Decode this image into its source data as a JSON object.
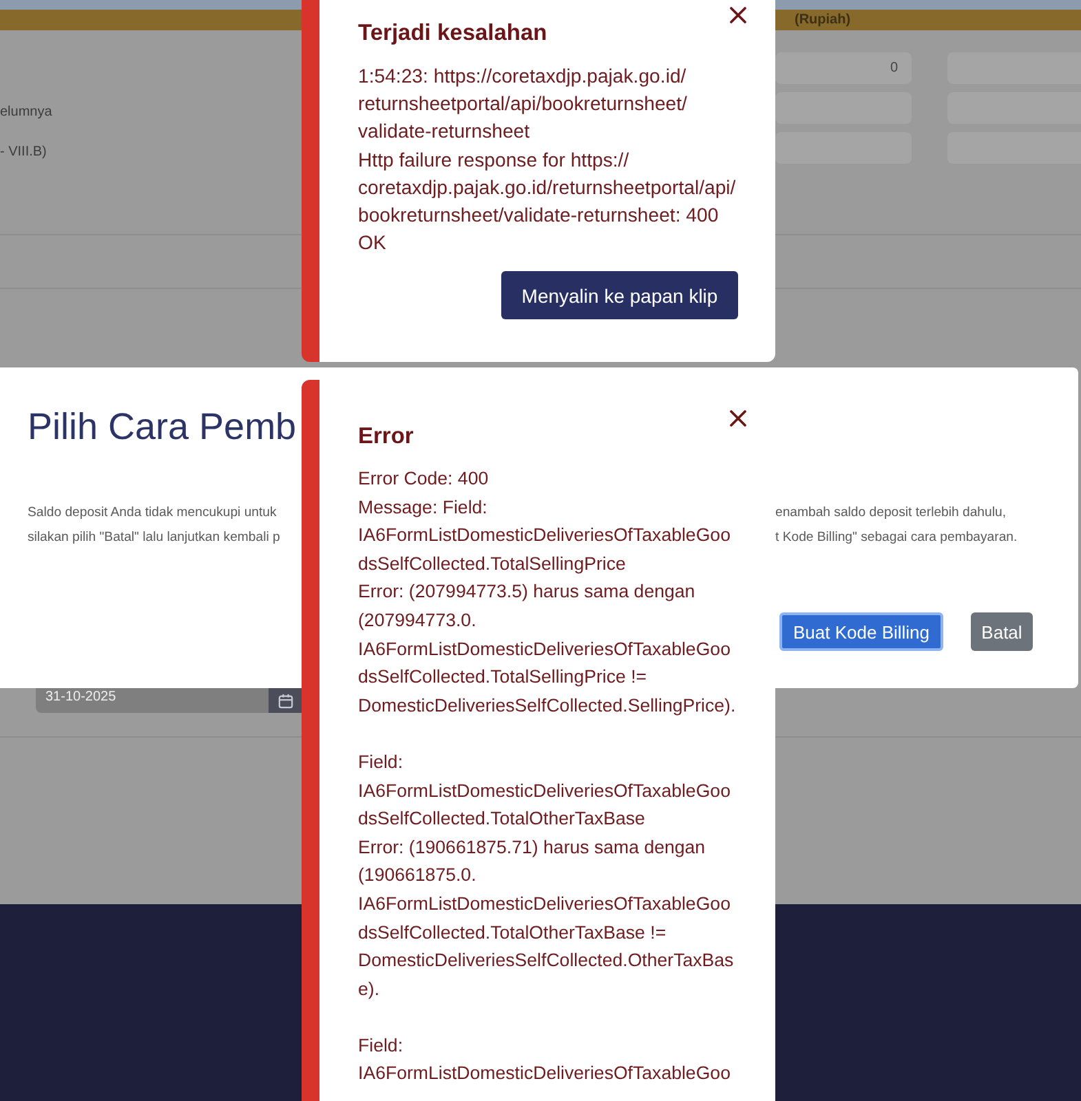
{
  "page": {
    "column_heading": "(Rupiah)",
    "form_rows": [
      {
        "first_value": "0"
      },
      {
        "label": "elumnya"
      },
      {
        "label": "- VIII.B)"
      }
    ],
    "date_field": {
      "value": "31-10-2025"
    }
  },
  "dialog": {
    "title": "Pilih Cara Pemb",
    "text_left": [
      "Saldo deposit Anda tidak mencukupi untuk",
      "silakan pilih \"Batal\" lalu lanjutkan kembali p"
    ],
    "text_right": [
      "enambah saldo deposit terlebih dahulu,",
      "t Kode Billing\" sebagai cara pembayaran."
    ],
    "buttons": [
      {
        "label": "Buat Kode Billing",
        "kind": "primary",
        "focused": true
      },
      {
        "label": "Batal",
        "kind": "secondary",
        "focused": false
      }
    ]
  },
  "toasts": [
    {
      "kind": "error",
      "title": "Terjadi kesalahan",
      "paragraphs": [
        [
          "1:54:23: https://coretaxdjp.pajak.go.id/returnsheetportal/api/bookreturnsheet/validate-returnsheet",
          "Http failure response for https://coretaxdjp.pajak.go.id/returnsheetportal/api/bookreturnsheet/validate-returnsheet: 400 OK"
        ]
      ],
      "action": "Menyalin ke papan klip"
    },
    {
      "kind": "error",
      "title": "Error",
      "paragraphs": [
        [
          "Error Code: 400",
          "Message: Field: IA6FormListDomesticDeliveriesOfTaxableGoodsSelfCollected.TotalSellingPrice",
          "Error: (207994773.5) harus sama dengan (207994773.0. IA6FormListDomesticDeliveriesOfTaxableGoodsSelfCollected.TotalSellingPrice != DomesticDeliveriesSelfCollected.SellingPrice)."
        ],
        [
          "Field: IA6FormListDomesticDeliveriesOfTaxableGoodsSelfCollected.TotalOtherTaxBase",
          "Error: (190661875.71) harus sama dengan (190661875.0. IA6FormListDomesticDeliveriesOfTaxableGoodsSelfCollected.TotalOtherTaxBase != DomesticDeliveriesSelfCollected.OtherTaxBase)."
        ],
        [
          "Field: IA6FormListDomesticDeliveriesOfTaxableGoo"
        ]
      ]
    }
  ]
}
